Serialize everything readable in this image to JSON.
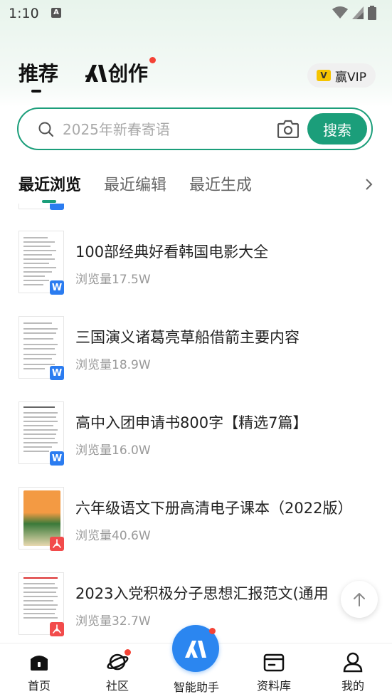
{
  "status_bar": {
    "time": "1:10",
    "notification_icon": "A"
  },
  "header": {
    "tab_recommend": "推荐",
    "tab_create": "创作",
    "vip_label": "赢VIP",
    "vip_icon": "V"
  },
  "search": {
    "placeholder": "2025年新春寄语",
    "button_label": "搜索"
  },
  "sub_tabs": [
    {
      "label": "最近浏览",
      "active": true
    },
    {
      "label": "最近编辑",
      "active": false
    },
    {
      "label": "最近生成",
      "active": false
    }
  ],
  "list": [
    {
      "title": "100部经典好看韩国电影大全",
      "views": "浏览量17.5W",
      "type": "word",
      "type_icon": "W"
    },
    {
      "title": "三国演义诸葛亮草船借箭主要内容",
      "views": "浏览量18.9W",
      "type": "word",
      "type_icon": "W"
    },
    {
      "title": "高中入团申请书800字【精选7篇】",
      "views": "浏览量16.0W",
      "type": "word",
      "type_icon": "W"
    },
    {
      "title": "六年级语文下册高清电子课本（2022版）",
      "views": "浏览量40.6W",
      "type": "pdf",
      "type_icon": "pdf"
    },
    {
      "title": "2023入党积极分子思想汇报范文(通用",
      "views": "浏览量32.7W",
      "type": "pdf",
      "type_icon": "pdf"
    }
  ],
  "bottom_nav": [
    {
      "label": "首页",
      "icon": "home-icon"
    },
    {
      "label": "社区",
      "icon": "planet-icon"
    },
    {
      "label": "智能助手",
      "icon": "ai-assistant-icon"
    },
    {
      "label": "资料库",
      "icon": "folder-icon"
    },
    {
      "label": "我的",
      "icon": "profile-icon"
    }
  ],
  "colors": {
    "accent": "#1b9e7a",
    "word_badge": "#2b7cf0",
    "pdf_badge": "#f24b4b",
    "ai_button": "#2b86f0",
    "red_dot": "#f44336"
  }
}
